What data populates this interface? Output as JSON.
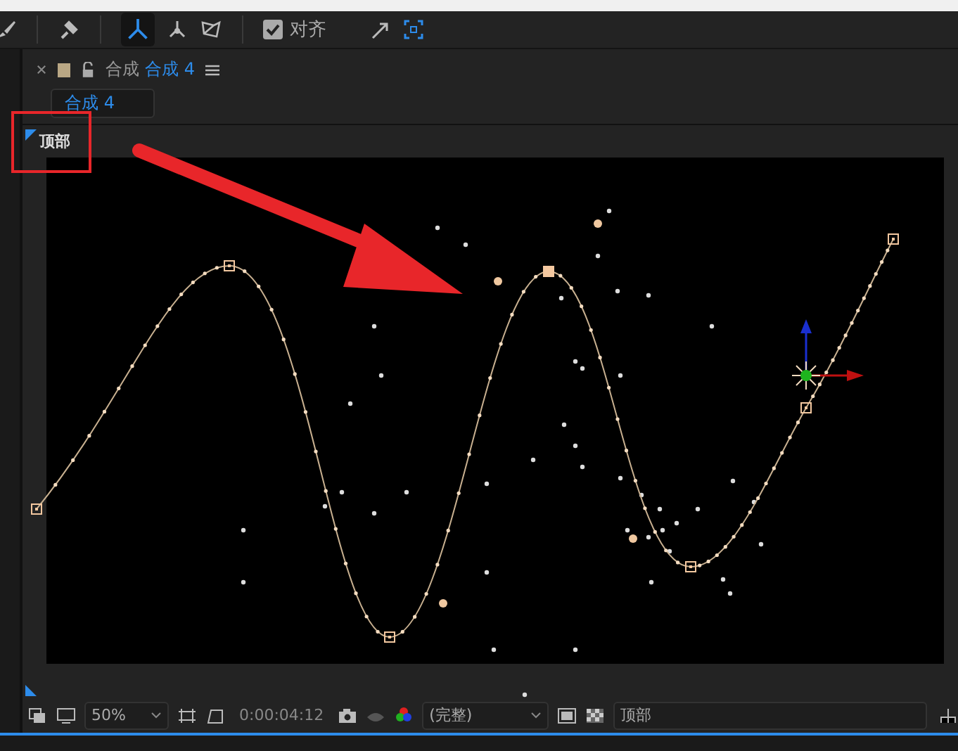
{
  "toolbar": {
    "snap": {
      "label": "对齐",
      "checked": true
    }
  },
  "panel": {
    "title": "合成",
    "comp_name": "合成 4",
    "locked": false,
    "comp_tab": {
      "label": "合成 4",
      "selected": true
    }
  },
  "viewer": {
    "view_label": "顶部"
  },
  "bottom_bar": {
    "zoom": "50%",
    "timecode": "0:00:04:12",
    "resolution": "(完整)",
    "view": "顶部"
  }
}
